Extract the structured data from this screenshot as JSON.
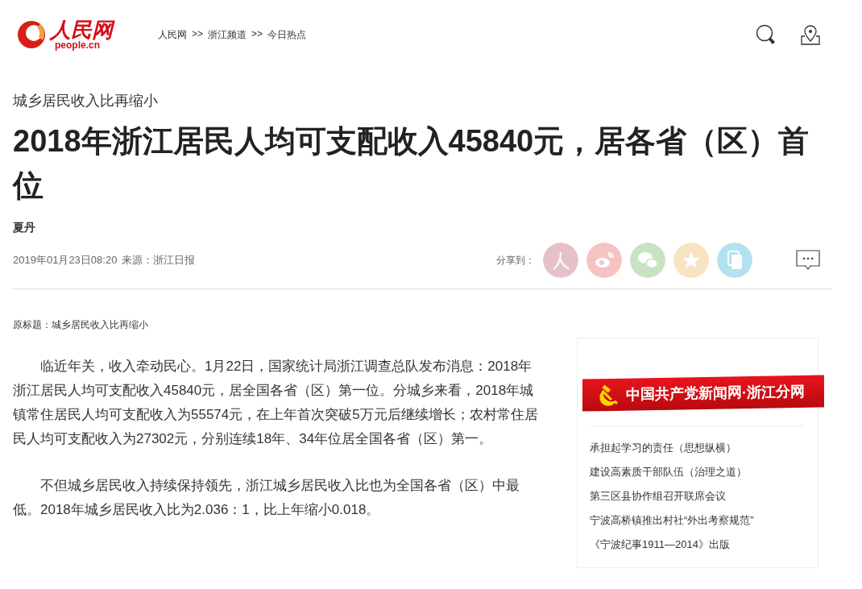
{
  "header": {
    "logo": {
      "name": "人民网",
      "domain": "people.cn"
    },
    "breadcrumb": [
      "人民网",
      ">>",
      "浙江频道",
      ">>",
      "今日热点"
    ]
  },
  "article": {
    "kicker": "城乡居民收入比再缩小",
    "title": "2018年浙江居民人均可支配收入45840元，居各省（区）首位",
    "author": "夏丹",
    "date": "2019年01月23日08:20",
    "source": "来源：浙江日报",
    "share_label": "分享到：",
    "share_buttons": [
      {
        "kind": "people",
        "color": "#e6c2c8"
      },
      {
        "kind": "weibo",
        "color": "#f6c3c3"
      },
      {
        "kind": "wechat",
        "color": "#c9e3c2"
      },
      {
        "kind": "qzone",
        "color": "#f8e3c3"
      },
      {
        "kind": "copy",
        "color": "#b3e1ee"
      }
    ],
    "original_title": "原标题：城乡居民收入比再缩小",
    "paragraphs": [
      "临近年关，收入牵动民心。1月22日，国家统计局浙江调查总队发布消息：2018年浙江居民人均可支配收入45840元，居全国各省（区）第一位。分城乡来看，2018年城镇常住居民人均可支配收入为55574元，在上年首次突破5万元后继续增长；农村常住居民人均可支配收入为27302元，分别连续18年、34年位居全国各省（区）第一。",
      "不但城乡居民收入持续保持领先，浙江城乡居民收入比也为全国各省（区）中最低。2018年城乡居民收入比为2.036：1，比上年缩小0.018。"
    ]
  },
  "sidebar": {
    "banner": "中国共产党新闻网·浙江分网",
    "links": [
      "承担起学习的责任（思想纵横）",
      "建设高素质干部队伍（治理之道）",
      "第三区县协作组召开联席会议",
      "宁波高桥镇推出村社“外出考察规范”",
      "《宁波纪事1911—2014》出版"
    ]
  }
}
